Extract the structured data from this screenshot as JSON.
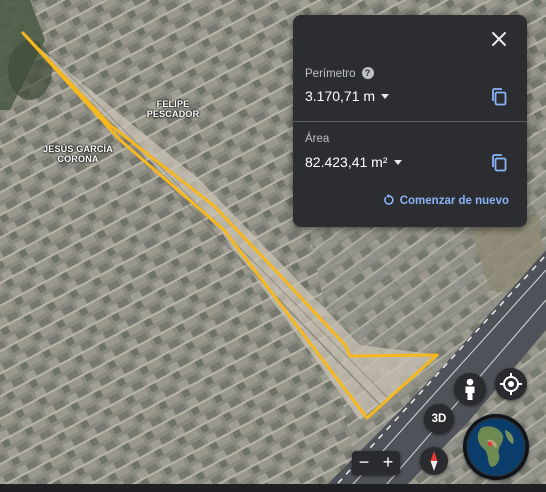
{
  "map": {
    "labels": [
      {
        "id": "felipe",
        "line1": "FELIPE",
        "line2": "PESCADOR"
      },
      {
        "id": "jesus",
        "line1": "JESÚS GARCÍA",
        "line2": "CORONA"
      }
    ],
    "polygon_color": "#f6b81d"
  },
  "measure_panel": {
    "perimeter_label": "Perímetro",
    "perimeter_value": "3.170,71 m",
    "area_label": "Área",
    "area_value": "82.423,41 m²",
    "restart_label": "Comenzar de nuevo",
    "accent_color": "#8ab4f8",
    "background_color": "#2b2d31"
  },
  "controls": {
    "three_d_label": "3D",
    "zoom_out": "−",
    "zoom_in": "+"
  }
}
